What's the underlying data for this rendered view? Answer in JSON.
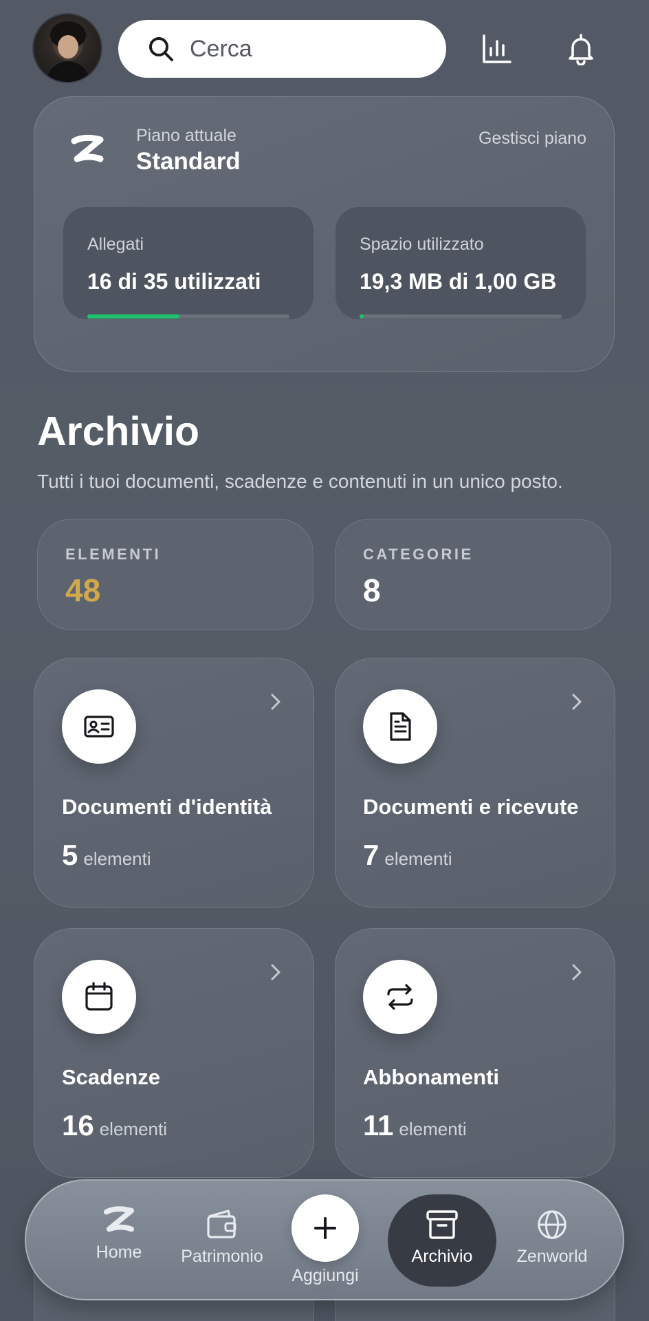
{
  "header": {
    "search_placeholder": "Cerca",
    "icons": [
      "avatar",
      "search-icon",
      "bar-chart-icon",
      "bell-icon"
    ]
  },
  "plan": {
    "caption": "Piano attuale",
    "name": "Standard",
    "manage_label": "Gestisci piano",
    "attachments": {
      "label": "Allegati",
      "value": "16 di 35 utilizzati",
      "progress": 0.457
    },
    "storage": {
      "label": "Spazio utilizzato",
      "value": "19,3 MB di 1,00 GB",
      "progress": 0.019
    }
  },
  "archive": {
    "title": "Archivio",
    "description": "Tutti i tuoi documenti, scadenze e contenuti in un unico posto.",
    "stats": [
      {
        "label": "ELEMENTI",
        "value": "48",
        "color": "#d2a94a"
      },
      {
        "label": "CATEGORIE",
        "value": "8",
        "color": "#ffffff"
      }
    ],
    "categories": [
      {
        "title": "Documenti d'identità",
        "count": "5",
        "unit": "elementi",
        "icon": "id-card-icon"
      },
      {
        "title": "Documenti e ricevute",
        "count": "7",
        "unit": "elementi",
        "icon": "document-icon"
      },
      {
        "title": "Scadenze",
        "count": "16",
        "unit": "elementi",
        "icon": "calendar-icon"
      },
      {
        "title": "Abbonamenti",
        "count": "11",
        "unit": "elementi",
        "icon": "repeat-icon"
      }
    ]
  },
  "nav": {
    "items": [
      {
        "label": "Home",
        "icon": "logo-icon"
      },
      {
        "label": "Patrimonio",
        "icon": "wallet-icon"
      },
      {
        "label": "Aggiungi",
        "icon": "plus-icon"
      },
      {
        "label": "Archivio",
        "icon": "archive-box-icon",
        "active": true
      },
      {
        "label": "Zenworld",
        "icon": "globe-icon"
      }
    ]
  },
  "colors": {
    "accent_green": "#1dc26a",
    "accent_gold": "#d2a94a",
    "background": "#555c67"
  }
}
